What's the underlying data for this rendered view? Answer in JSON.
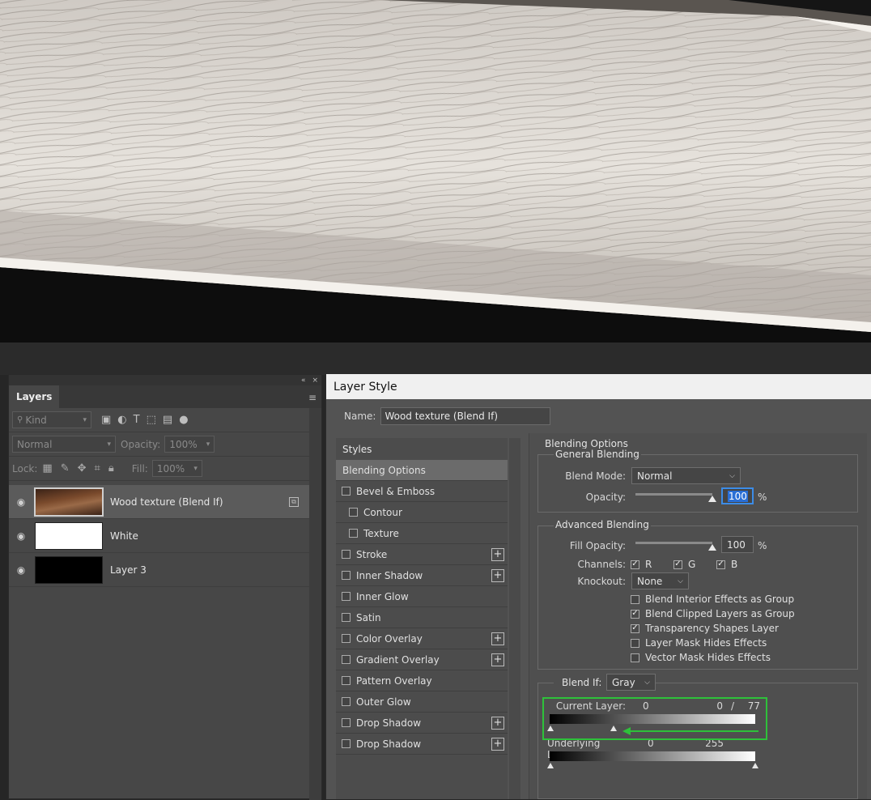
{
  "canvas": {
    "description_icon": "wood-photo"
  },
  "layers_panel": {
    "tab_label": "Layers",
    "collapse_icon": "«",
    "close_icon": "×",
    "menu_icon": "≡",
    "filter_kind": "Kind",
    "blend_mode": "Normal",
    "opacity_label": "Opacity:",
    "opacity_value": "100%",
    "lock_label": "Lock:",
    "fill_label": "Fill:",
    "fill_value": "100%",
    "layers": [
      {
        "name": "Wood texture (Blend If)",
        "selected": true
      },
      {
        "name": "White",
        "selected": false
      },
      {
        "name": "Layer 3",
        "selected": false
      }
    ]
  },
  "dialog": {
    "title": "Layer Style",
    "name_label": "Name:",
    "name_value": "Wood texture (Blend If)",
    "styles_header": "Styles",
    "styles": [
      {
        "label": "Blending Options",
        "active": true,
        "checkbox": false,
        "plus": false,
        "indent": false
      },
      {
        "label": "Bevel & Emboss",
        "checkbox": true,
        "plus": false,
        "indent": false
      },
      {
        "label": "Contour",
        "checkbox": true,
        "plus": false,
        "indent": true
      },
      {
        "label": "Texture",
        "checkbox": true,
        "plus": false,
        "indent": true
      },
      {
        "label": "Stroke",
        "checkbox": true,
        "plus": true,
        "indent": false
      },
      {
        "label": "Inner Shadow",
        "checkbox": true,
        "plus": true,
        "indent": false
      },
      {
        "label": "Inner Glow",
        "checkbox": true,
        "plus": false,
        "indent": false
      },
      {
        "label": "Satin",
        "checkbox": true,
        "plus": false,
        "indent": false
      },
      {
        "label": "Color Overlay",
        "checkbox": true,
        "plus": true,
        "indent": false
      },
      {
        "label": "Gradient Overlay",
        "checkbox": true,
        "plus": true,
        "indent": false
      },
      {
        "label": "Pattern Overlay",
        "checkbox": true,
        "plus": false,
        "indent": false
      },
      {
        "label": "Outer Glow",
        "checkbox": true,
        "plus": false,
        "indent": false
      },
      {
        "label": "Drop Shadow",
        "checkbox": true,
        "plus": true,
        "indent": false
      },
      {
        "label": "Drop Shadow",
        "checkbox": true,
        "plus": true,
        "indent": false
      }
    ],
    "blending_options_title": "Blending Options",
    "general_blending": {
      "title": "General Blending",
      "blend_mode_label": "Blend Mode:",
      "blend_mode_value": "Normal",
      "opacity_label": "Opacity:",
      "opacity_value": "100",
      "opacity_unit": "%",
      "opacity_fraction": 1.0
    },
    "advanced_blending": {
      "title": "Advanced Blending",
      "fill_opacity_label": "Fill Opacity:",
      "fill_opacity_value": "100",
      "fill_opacity_unit": "%",
      "fill_opacity_fraction": 1.0,
      "channels_label": "Channels:",
      "channels": [
        {
          "label": "R",
          "checked": true
        },
        {
          "label": "G",
          "checked": true
        },
        {
          "label": "B",
          "checked": true
        }
      ],
      "knockout_label": "Knockout:",
      "knockout_value": "None",
      "options": [
        {
          "label": "Blend Interior Effects as Group",
          "checked": false
        },
        {
          "label": "Blend Clipped Layers as Group",
          "checked": true
        },
        {
          "label": "Transparency Shapes Layer",
          "checked": true
        },
        {
          "label": "Layer Mask Hides Effects",
          "checked": false
        },
        {
          "label": "Vector Mask Hides Effects",
          "checked": false
        }
      ]
    },
    "blend_if": {
      "label": "Blend If:",
      "channel_value": "Gray",
      "current_layer_label": "Current Layer:",
      "current_left": "0",
      "current_right_a": "0",
      "current_right_sep": "/",
      "current_right_b": "77",
      "underlying_layer_label": "Underlying Layer:",
      "underlying_left": "0",
      "underlying_right": "255"
    },
    "accent_color": "#2ec13a"
  }
}
